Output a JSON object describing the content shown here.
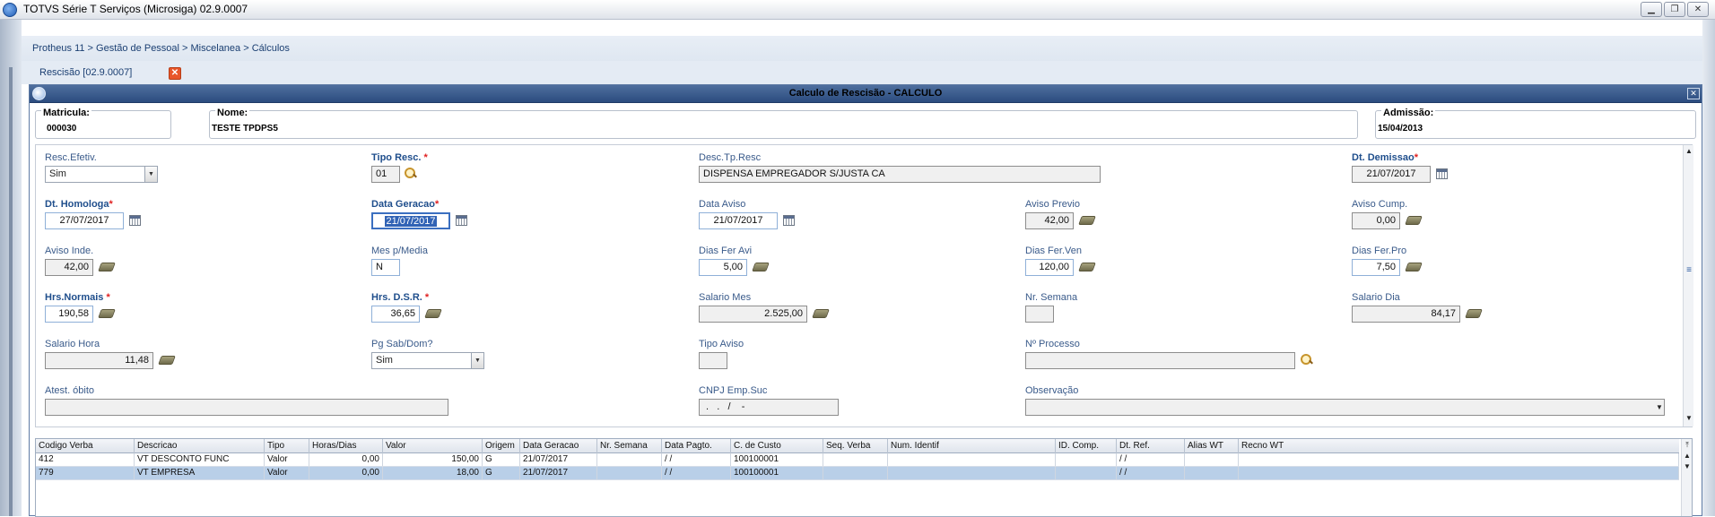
{
  "window": {
    "title": "TOTVS Série T Serviços (Microsiga) 02.9.0007",
    "minimize": "▁",
    "restore": "❐",
    "close": "✕"
  },
  "breadcrumb": "Protheus 11 > Gestão de Pessoal > Miscelanea > Cálculos",
  "tab": {
    "label": "Rescisão [02.9.0007]",
    "close": "✕"
  },
  "dialog": {
    "title": "Calculo de Rescisão - CALCULO",
    "close": "✕"
  },
  "header": {
    "matricula_label": "Matricula:",
    "matricula": "000030",
    "nome_label": "Nome:",
    "nome": "TESTE TPDPS5",
    "admissao_label": "Admissão:",
    "admissao": "15/04/2013"
  },
  "form": {
    "resc_efetiv_label": "Resc.Efetiv.",
    "resc_efetiv": "Sim",
    "tipo_resc_label": "Tipo Resc.",
    "tipo_resc": "01",
    "desc_tp_resc_label": "Desc.Tp.Resc",
    "desc_tp_resc": "DISPENSA EMPREGADOR S/JUSTA CA",
    "dt_demissao_label": "Dt. Demissao",
    "dt_demissao": "21/07/2017",
    "dt_homologa_label": "Dt. Homologa",
    "dt_homologa": "27/07/2017",
    "data_geracao_label": "Data Geracao",
    "data_geracao": "21/07/2017",
    "data_aviso_label": "Data Aviso",
    "data_aviso": "21/07/2017",
    "aviso_previo_label": "Aviso Previo",
    "aviso_previo": "42,00",
    "aviso_cump_label": "Aviso Cump.",
    "aviso_cump": "0,00",
    "aviso_inde_label": "Aviso Inde.",
    "aviso_inde": "42,00",
    "mes_media_label": "Mes p/Media",
    "mes_media": "N",
    "dias_fer_avi_label": "Dias Fer Avi",
    "dias_fer_avi": "5,00",
    "dias_fer_ven_label": "Dias Fer.Ven",
    "dias_fer_ven": "120,00",
    "dias_fer_pro_label": "Dias Fer.Pro",
    "dias_fer_pro": "7,50",
    "hrs_normais_label": "Hrs.Normais",
    "hrs_normais": "190,58",
    "hrs_dsr_label": "Hrs. D.S.R.",
    "hrs_dsr": "36,65",
    "salario_mes_label": "Salario Mes",
    "salario_mes": "2.525,00",
    "nr_semana_label": "Nr. Semana",
    "nr_semana": "",
    "salario_dia_label": "Salario Dia",
    "salario_dia": "84,17",
    "salario_hora_label": "Salario Hora",
    "salario_hora": "11,48",
    "pg_sab_dom_label": "Pg Sab/Dom?",
    "pg_sab_dom": "Sim",
    "tipo_aviso_label": "Tipo Aviso",
    "tipo_aviso": "",
    "n_processo_label": "Nº Processo",
    "n_processo": "",
    "atest_obito_label": "Atest. óbito",
    "atest_obito": "",
    "cnpj_emp_suc_label": "CNPJ Emp.Suc",
    "cnpj_emp_suc": " .   .   /    -",
    "observacao_label": "Observação",
    "observacao": "",
    "required_mark": "*"
  },
  "grid": {
    "columns": [
      "Codigo Verba",
      "Descricao",
      "Tipo",
      "Horas/Dias",
      "Valor",
      "Origem",
      "Data Geracao",
      "Nr. Semana",
      "Data Pagto.",
      "C. de Custo",
      "Seq. Verba",
      "Num. Identif",
      "ID. Comp.",
      "Dt. Ref.",
      "Alias WT",
      "Recno WT"
    ],
    "rows": [
      [
        "412",
        "VT DESCONTO FUNC",
        "Valor",
        "0,00",
        "150,00",
        "G",
        "21/07/2017",
        "",
        " / /",
        "100100001",
        "",
        "",
        "",
        " / /",
        "",
        ""
      ],
      [
        "779",
        "VT EMPRESA",
        "Valor",
        "0,00",
        "18,00",
        "G",
        "21/07/2017",
        "",
        " / /",
        "100100001",
        "",
        "",
        "",
        " / /",
        "",
        ""
      ]
    ],
    "selected_row": 1
  },
  "icons": {
    "search": "search-icon",
    "calendar": "calendar-icon",
    "calculator": "calculator-icon"
  },
  "colors": {
    "title_bar": "#2b4c7f",
    "label": "#395a8a",
    "required": "#e02020",
    "selected_row": "#b9cfe8",
    "tab_close": "#e8562a"
  }
}
